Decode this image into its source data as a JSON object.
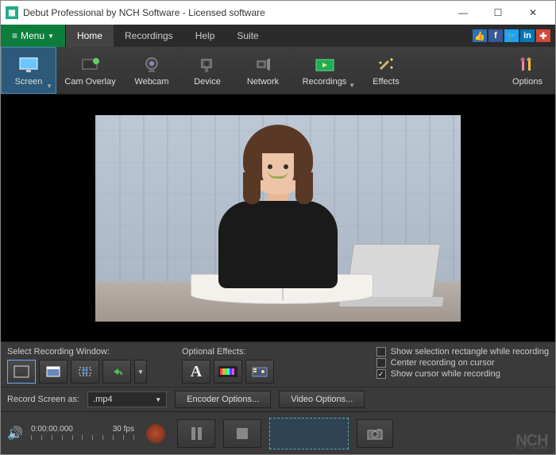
{
  "window": {
    "title": "Debut Professional by NCH Software - Licensed software"
  },
  "menubar": {
    "menu_label": "Menu",
    "tabs": [
      "Home",
      "Recordings",
      "Help",
      "Suite"
    ]
  },
  "toolbar": {
    "items": [
      {
        "label": "Screen",
        "icon": "monitor"
      },
      {
        "label": "Cam Overlay",
        "icon": "cam-overlay"
      },
      {
        "label": "Webcam",
        "icon": "webcam"
      },
      {
        "label": "Device",
        "icon": "device"
      },
      {
        "label": "Network",
        "icon": "network"
      },
      {
        "label": "Recordings",
        "icon": "recordings"
      },
      {
        "label": "Effects",
        "icon": "effects"
      },
      {
        "label": "Options",
        "icon": "options"
      }
    ]
  },
  "panel": {
    "select_window_label": "Select Recording Window:",
    "effects_label": "Optional Effects:",
    "checks": {
      "show_selection": "Show selection rectangle while recording",
      "center_cursor": "Center recording on cursor",
      "show_cursor": "Show cursor while recording"
    }
  },
  "panel2": {
    "record_as_label": "Record Screen as:",
    "format": ".mp4",
    "encoder_btn": "Encoder Options...",
    "video_btn": "Video Options..."
  },
  "controlbar": {
    "time": "0:00:00.000",
    "fps": "30 fps"
  },
  "logo": {
    "brand": "NCH",
    "sub": "SOFTWARE"
  }
}
